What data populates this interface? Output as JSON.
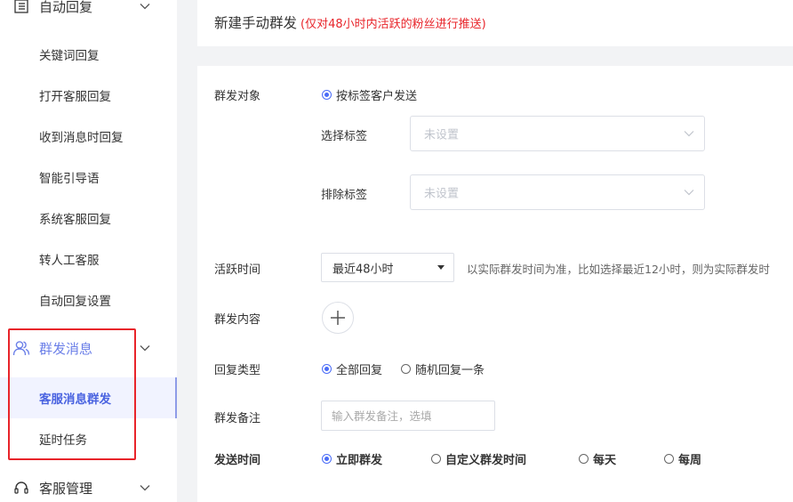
{
  "sidebar": {
    "groups": [
      {
        "label": "自动回复"
      },
      {
        "label": "群发消息"
      },
      {
        "label": "客服管理"
      }
    ],
    "items": [
      {
        "label": "关键词回复"
      },
      {
        "label": "打开客服回复"
      },
      {
        "label": "收到消息时回复"
      },
      {
        "label": "智能引导语"
      },
      {
        "label": "系统客服回复"
      },
      {
        "label": "转人工客服"
      },
      {
        "label": "自动回复设置"
      },
      {
        "label": "客服消息群发"
      },
      {
        "label": "延时任务"
      }
    ]
  },
  "header": {
    "title": "新建手动群发",
    "note": "(仅对48小时内活跃的粉丝进行推送)"
  },
  "form": {
    "target": {
      "label": "群发对象",
      "option": "按标签客户发送",
      "select_tag_label": "选择标签",
      "select_tag_placeholder": "未设置",
      "exclude_tag_label": "排除标签",
      "exclude_tag_placeholder": "未设置"
    },
    "active_time": {
      "label": "活跃时间",
      "value": "最近48小时",
      "hint": "以实际群发时间为准，比如选择最近12小时，则为实际群发时"
    },
    "content": {
      "label": "群发内容"
    },
    "reply_type": {
      "label": "回复类型",
      "options": [
        "全部回复",
        "随机回复一条"
      ]
    },
    "remark": {
      "label": "群发备注",
      "placeholder": "输入群发备注，选填"
    },
    "send_time": {
      "label": "发送时间",
      "options": [
        "立即群发",
        "自定义群发时间",
        "每天",
        "每周"
      ]
    }
  },
  "colors": {
    "accent": "#4a6cf7",
    "active_nav": "#6b7fe8",
    "warning": "#e8242a"
  }
}
